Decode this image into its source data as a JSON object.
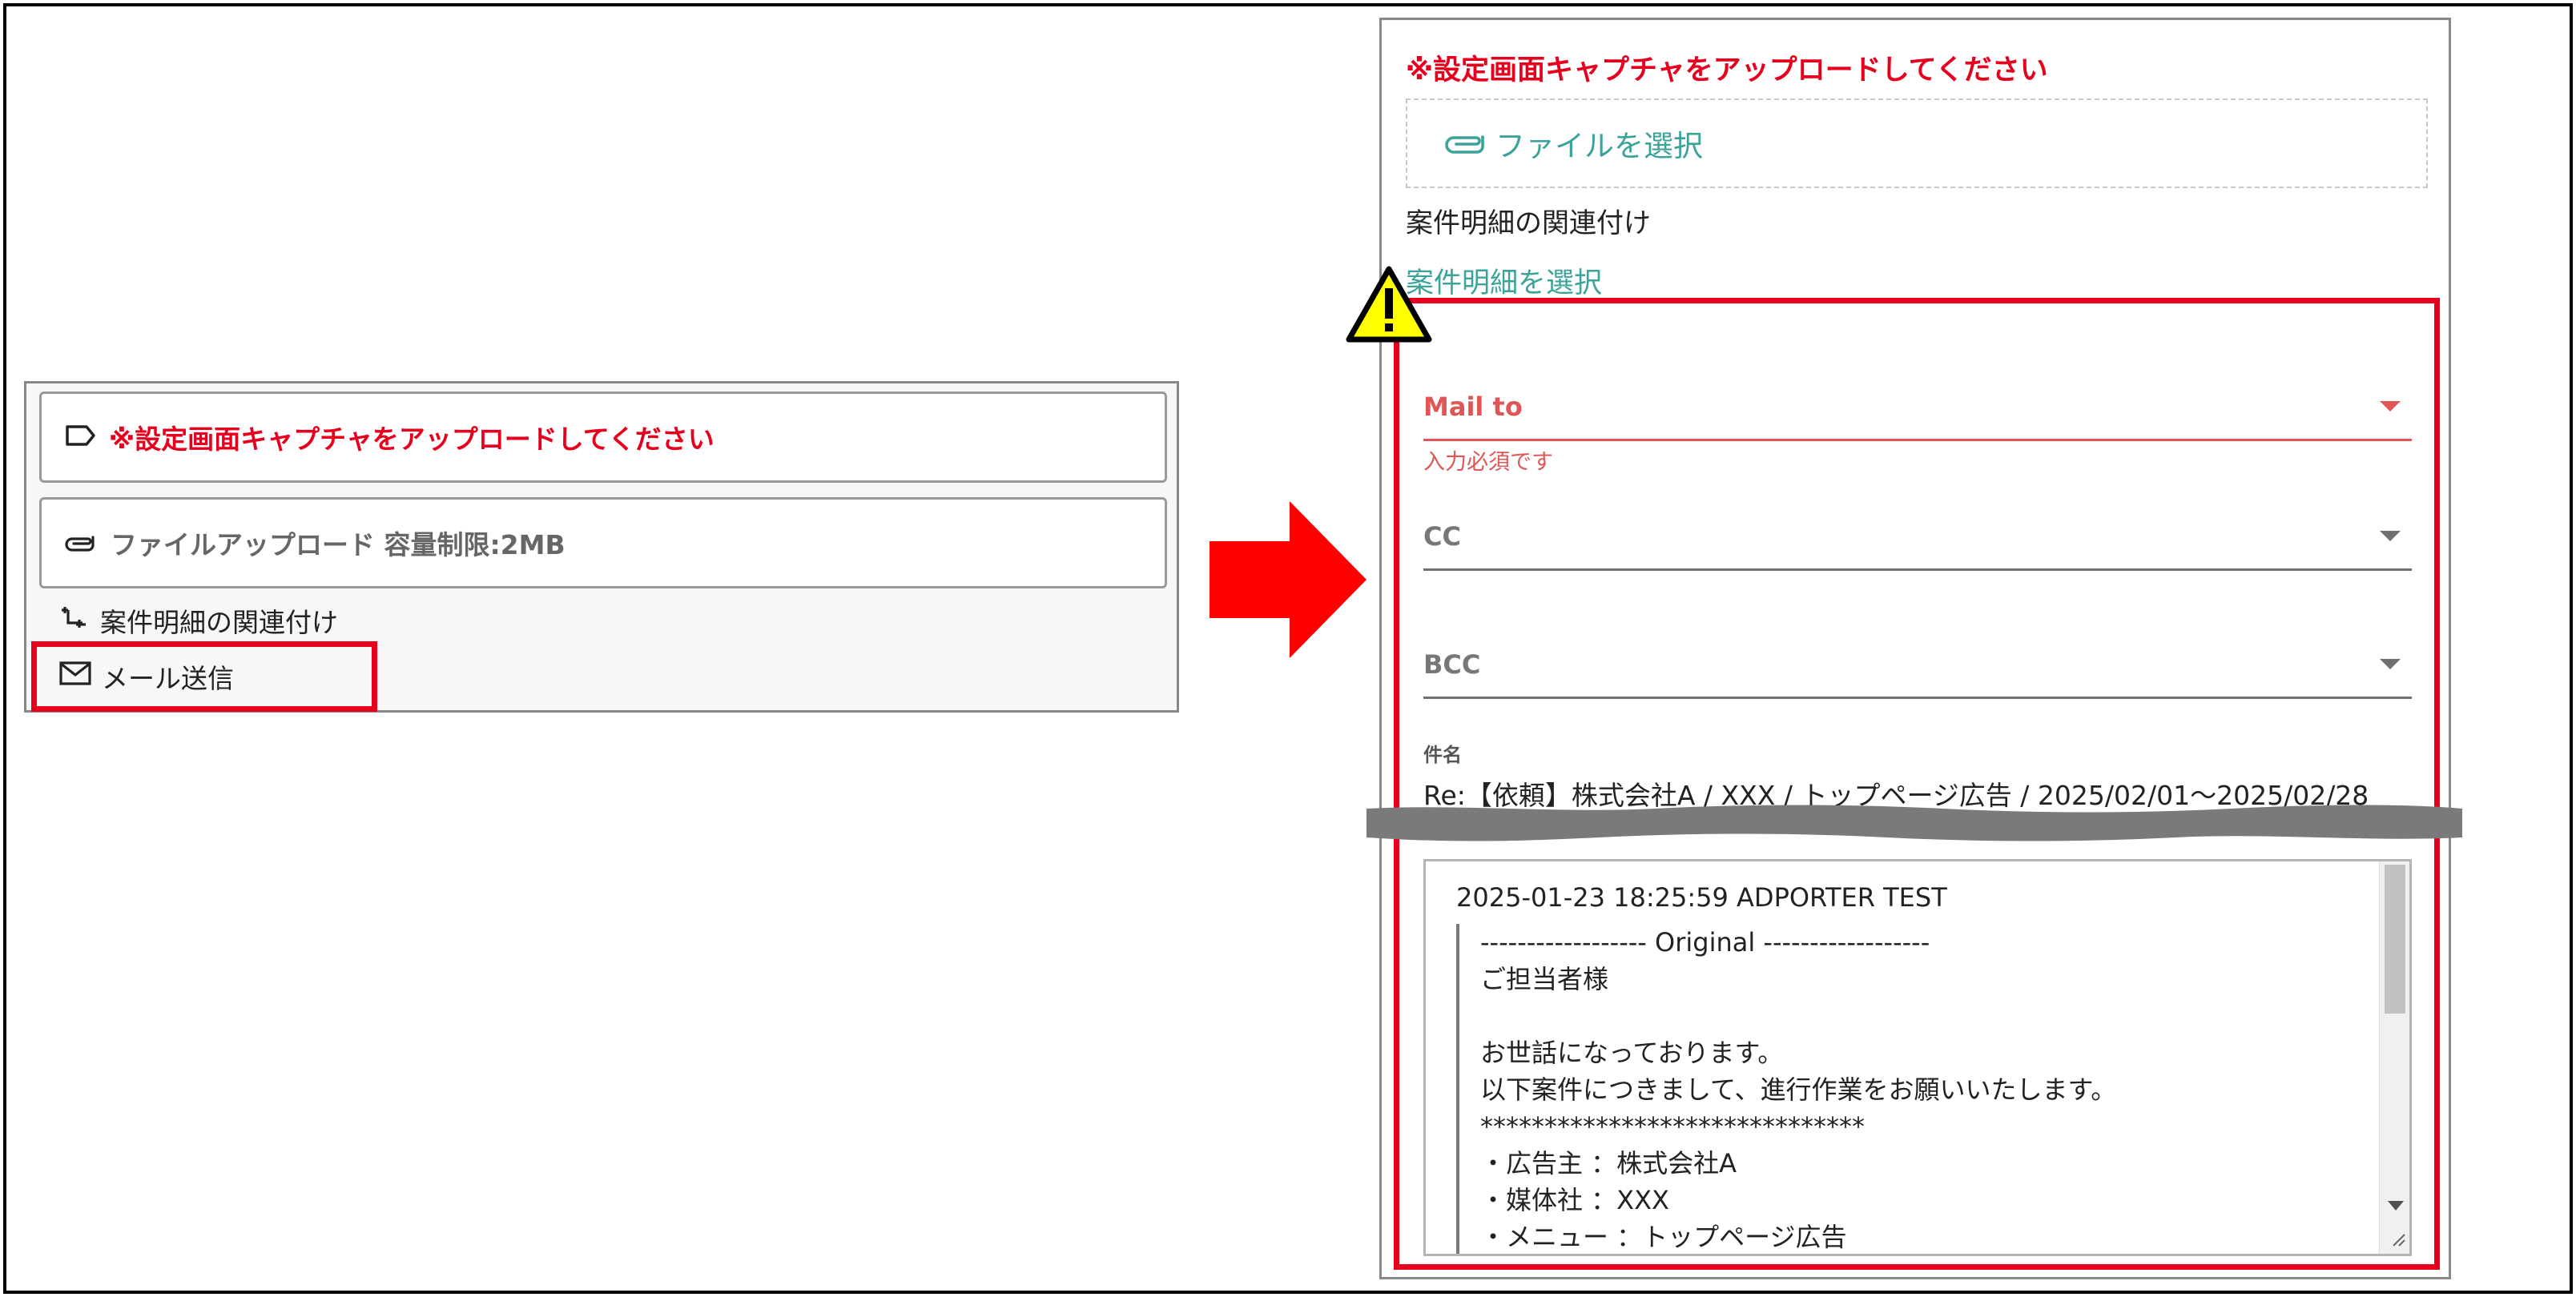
{
  "left": {
    "card_warning": "※設定画面キャプチャをアップロードしてください",
    "card_upload": "ファイルアップロード 容量制限:2MB",
    "item_relate": "案件明細の関連付け",
    "item_mail": "メール送信"
  },
  "right": {
    "warning": "※設定画面キャプチャをアップロードしてください",
    "file_select": "ファイルを選択",
    "relate_label": "案件明細の関連付け",
    "select_link": "案件明細を選択",
    "mail_to_label": "Mail to",
    "required_msg": "入力必須です",
    "cc_label": "CC",
    "bcc_label": "BCC",
    "subject_label": "件名",
    "subject_value": "Re:【依頼】株式会社A / XXX / トップページ広告 / 2025/02/01～2025/02/28",
    "body": {
      "header": "2025-01-23 18:25:59 ADPORTER TEST",
      "quote_lines": [
        "------------------ Original ------------------",
        "ご担当者様",
        "",
        "お世話になっております。",
        "以下案件につきまして、進行作業をお願いいたします。",
        "******************************",
        "・広告主 ：株式会社A",
        "・媒体社 ：XXX",
        "・メニュー ：トップページ広告"
      ]
    }
  },
  "colors": {
    "accent_red": "#e7001d",
    "teal_link": "#3ba39a",
    "error_red": "#e05555"
  },
  "icons": [
    "tag-icon",
    "paperclip-icon",
    "relation-icon",
    "mail-icon",
    "right-arrow-icon",
    "warning-icon",
    "chevron-down-icon",
    "resize-grip-icon"
  ]
}
